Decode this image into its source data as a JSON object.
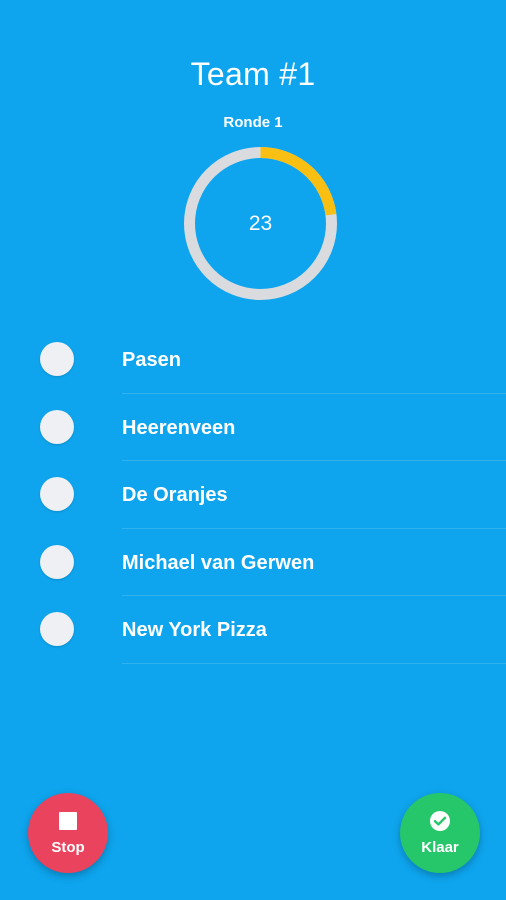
{
  "header": {
    "team_title": "Team #1",
    "round_label": "Ronde 1"
  },
  "timer": {
    "seconds_left": "23",
    "progress_fraction": 0.23,
    "track_color": "#d9dbde",
    "progress_color": "#f9bf12"
  },
  "words": [
    {
      "label": "Pasen"
    },
    {
      "label": "Heerenveen"
    },
    {
      "label": "De Oranjes"
    },
    {
      "label": "Michael van Gerwen"
    },
    {
      "label": "New York Pizza"
    }
  ],
  "actions": {
    "stop": {
      "label": "Stop",
      "icon": "stop-icon",
      "color": "#e9435e"
    },
    "done": {
      "label": "Klaar",
      "icon": "check-circle-icon",
      "color": "#26c76a"
    }
  },
  "colors": {
    "background": "#0ea5ee"
  }
}
